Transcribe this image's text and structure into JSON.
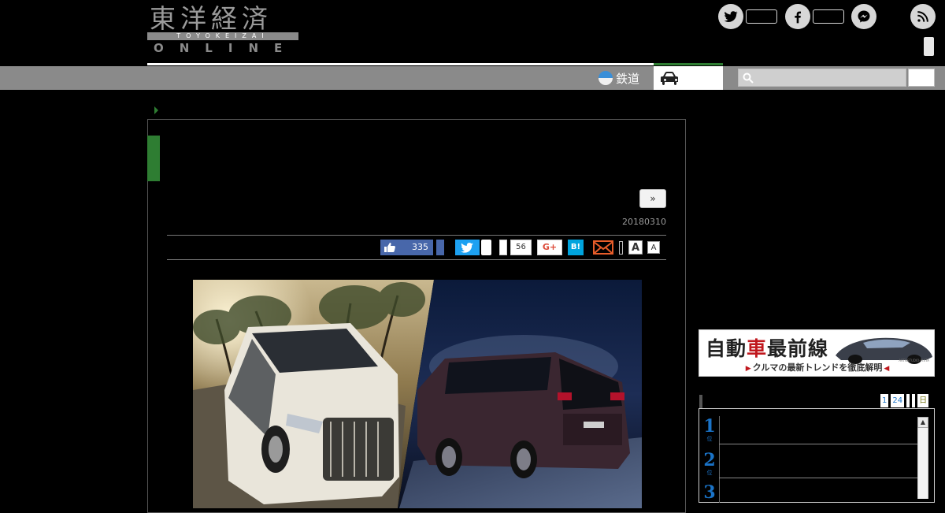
{
  "logo": {
    "kanji": [
      "東",
      "洋",
      "経",
      "済"
    ],
    "band_text": "TOYOKEIZAI",
    "online_text": "ONLINE"
  },
  "social": {
    "twitter": "twitter-icon",
    "facebook": "facebook-icon",
    "messenger": "messenger-icon",
    "rss": "rss-icon"
  },
  "nav": {
    "rail_label": "鉄道"
  },
  "article": {
    "next_label": "»",
    "date": "20180310",
    "share": {
      "like_count": "335",
      "hatena_count": "56",
      "gplus_label": "G+",
      "hatena_label": "B!",
      "font_large_label": "A",
      "font_small_label": "A"
    }
  },
  "sidebar": {
    "banner": {
      "title_a": "自動",
      "title_red": "車",
      "title_b": "最前線",
      "subtitle": "クルマの最新トレンドを徹底解明",
      "credit": "ARTNSTUDIO-PIXTA"
    },
    "ranking": {
      "tabs": [
        "1",
        "24",
        "",
        "",
        "日"
      ],
      "rows": [
        {
          "rank": "1",
          "unit": "位"
        },
        {
          "rank": "2",
          "unit": "位"
        },
        {
          "rank": "3",
          "unit": "位"
        }
      ],
      "scroll_up": "▲"
    }
  },
  "colors": {
    "accent_green": "#2e7d32",
    "nav_gray": "#8a8a8a",
    "facebook_blue": "#4867aa",
    "twitter_blue": "#1da1f2",
    "hatena_blue": "#00a4de",
    "link_blue": "#1a73c7"
  }
}
